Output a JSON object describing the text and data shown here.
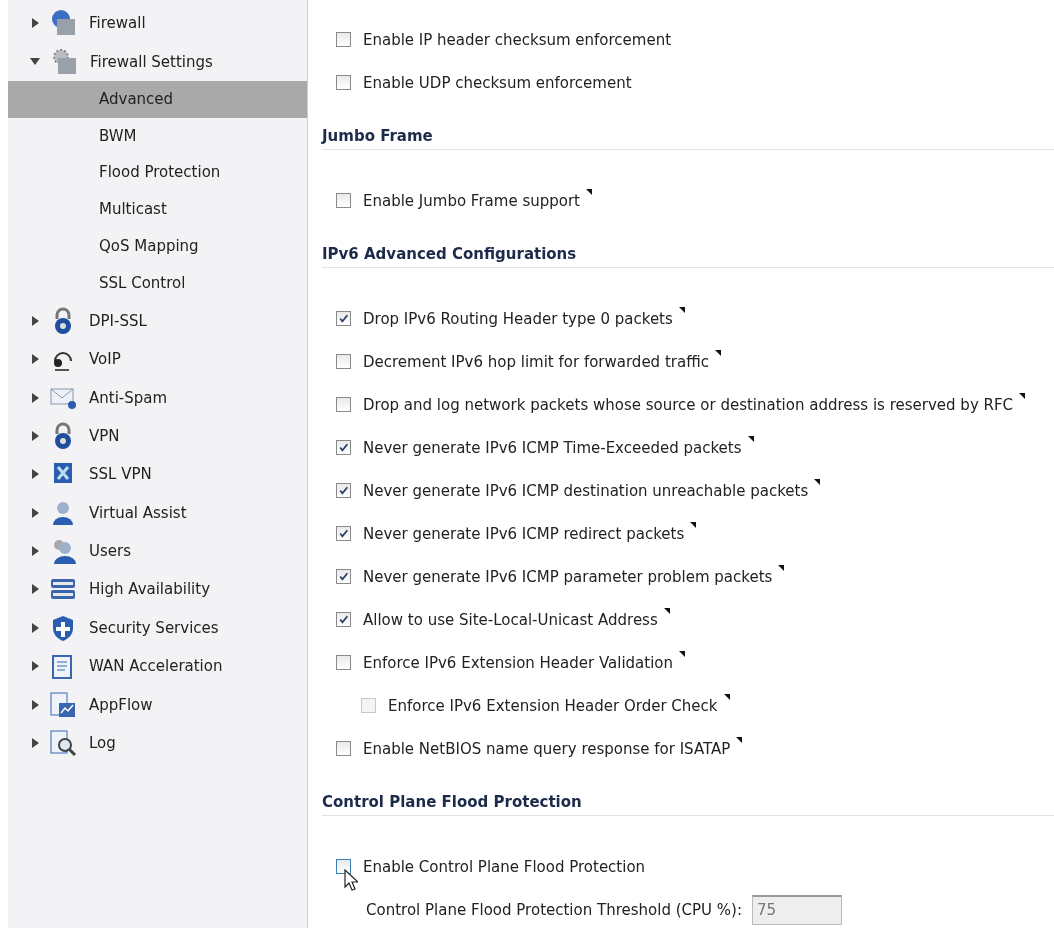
{
  "sidebar": {
    "items": [
      {
        "label": "Firewall",
        "expanded": false
      },
      {
        "label": "Firewall Settings",
        "expanded": true,
        "children": [
          {
            "label": "Advanced",
            "selected": true
          },
          {
            "label": "BWM",
            "selected": false
          },
          {
            "label": "Flood Protection",
            "selected": false
          },
          {
            "label": "Multicast",
            "selected": false
          },
          {
            "label": "QoS Mapping",
            "selected": false
          },
          {
            "label": "SSL Control",
            "selected": false
          }
        ]
      },
      {
        "label": "DPI-SSL",
        "expanded": false
      },
      {
        "label": "VoIP",
        "expanded": false
      },
      {
        "label": "Anti-Spam",
        "expanded": false
      },
      {
        "label": "VPN",
        "expanded": false
      },
      {
        "label": "SSL VPN",
        "expanded": false
      },
      {
        "label": "Virtual Assist",
        "expanded": false
      },
      {
        "label": "Users",
        "expanded": false
      },
      {
        "label": "High Availability",
        "expanded": false
      },
      {
        "label": "Security Services",
        "expanded": false
      },
      {
        "label": "WAN Acceleration",
        "expanded": false
      },
      {
        "label": "AppFlow",
        "expanded": false
      },
      {
        "label": "Log",
        "expanded": false
      }
    ]
  },
  "settings": [
    {
      "kind": "checkbox",
      "label": "Enable IP header checksum enforcement",
      "checked": false
    },
    {
      "kind": "checkbox",
      "label": "Enable UDP checksum enforcement",
      "checked": false
    },
    {
      "kind": "heading",
      "label": "Jumbo Frame"
    },
    {
      "kind": "checkbox",
      "label": "Enable Jumbo Frame support",
      "checked": false,
      "help": true
    },
    {
      "kind": "heading",
      "label": "IPv6 Advanced Configurations"
    },
    {
      "kind": "checkbox",
      "label": "Drop IPv6 Routing Header type 0 packets",
      "checked": true,
      "help": true
    },
    {
      "kind": "checkbox",
      "label": "Decrement IPv6 hop limit for forwarded traffic",
      "checked": false,
      "help": true
    },
    {
      "kind": "checkbox",
      "label": "Drop and log network packets whose source or destination address is reserved by RFC",
      "checked": false,
      "help": true
    },
    {
      "kind": "checkbox",
      "label": "Never generate IPv6 ICMP Time-Exceeded packets",
      "checked": true,
      "help": true
    },
    {
      "kind": "checkbox",
      "label": "Never generate IPv6 ICMP destination unreachable packets",
      "checked": true,
      "help": true
    },
    {
      "kind": "checkbox",
      "label": "Never generate IPv6 ICMP redirect packets",
      "checked": true,
      "help": true
    },
    {
      "kind": "checkbox",
      "label": "Never generate IPv6 ICMP parameter problem packets",
      "checked": true,
      "help": true
    },
    {
      "kind": "checkbox",
      "label": "Allow to use Site-Local-Unicast Address",
      "checked": true,
      "help": true
    },
    {
      "kind": "checkbox",
      "label": "Enforce IPv6 Extension Header Validation",
      "checked": false,
      "help": true,
      "children": [
        {
          "kind": "checkbox",
          "label": "Enforce IPv6 Extension Header Order Check",
          "checked": false,
          "help": true,
          "disabled": true
        }
      ]
    },
    {
      "kind": "checkbox",
      "label": "Enable NetBIOS name query response for ISATAP",
      "checked": false,
      "help": true
    },
    {
      "kind": "heading",
      "label": "Control Plane Flood Protection"
    },
    {
      "kind": "checkbox",
      "label": "Enable Control Plane Flood Protection",
      "checked": false,
      "hover": true
    },
    {
      "kind": "input",
      "label": "Control Plane Flood Protection Threshold (CPU %):",
      "value": "75",
      "disabled": true
    }
  ]
}
